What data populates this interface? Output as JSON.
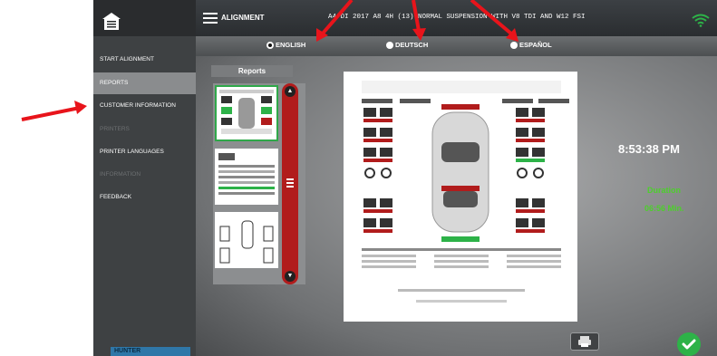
{
  "header": {
    "section_title": "ALIGNMENT",
    "vehicle": "A4 DI 2017 A8 4H (13) NORMAL SUSPENSION WITH V8 TDI AND W12 FSI"
  },
  "languages": [
    {
      "label": "ENGLISH",
      "selected": true
    },
    {
      "label": "DEUTSCH",
      "selected": false
    },
    {
      "label": "ESPAÑOL",
      "selected": false
    }
  ],
  "sidebar": {
    "items": [
      {
        "label": "START ALIGNMENT",
        "state": "normal"
      },
      {
        "label": "REPORTS",
        "state": "active"
      },
      {
        "label": "CUSTOMER INFORMATION",
        "state": "normal"
      },
      {
        "label": "PRINTERS",
        "state": "disabled"
      },
      {
        "label": "PRINTER LANGUAGES",
        "state": "normal"
      },
      {
        "label": "INFORMATION",
        "state": "disabled"
      },
      {
        "label": "FEEDBACK",
        "state": "normal"
      }
    ],
    "brand": "HUNTER"
  },
  "reports": {
    "title": "Reports"
  },
  "status": {
    "time": "8:53:38 PM",
    "duration_label": "Duration",
    "duration_value": "06:56 Min."
  },
  "colors": {
    "accent_green": "#2db248",
    "annotation_red": "#e8141b",
    "scroll_red": "#b11c1c"
  },
  "icons": [
    "home-icon",
    "menu-icon",
    "wifi-icon",
    "printer-icon",
    "checkmark-icon",
    "scroll-up-icon",
    "scroll-down-icon"
  ]
}
